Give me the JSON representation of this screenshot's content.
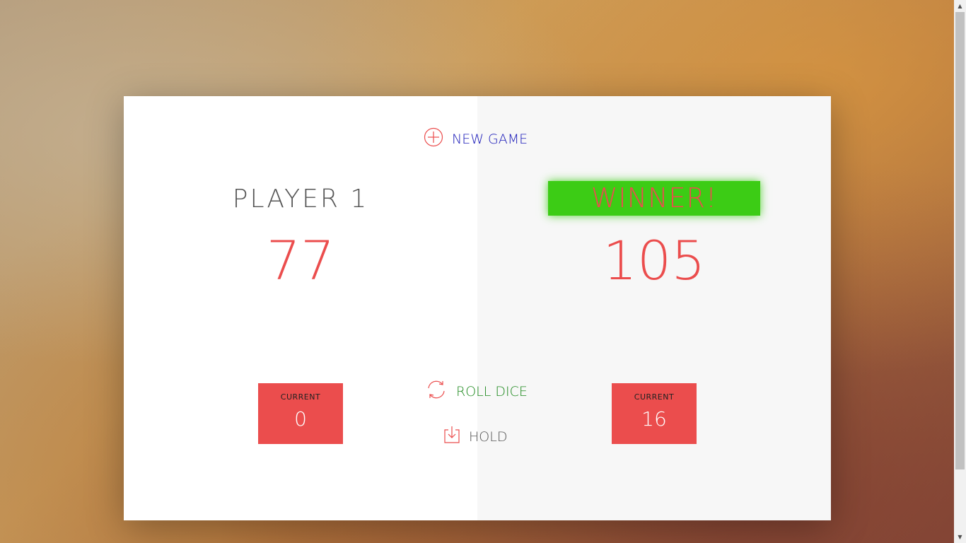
{
  "game": {
    "new_game_label": "NEW GAME",
    "roll_dice_label": "ROLL DICE",
    "hold_label": "HOLD"
  },
  "players": [
    {
      "name": "PLAYER 1",
      "score": "77",
      "current_label": "CURRENT",
      "current_score": "0"
    },
    {
      "name": "WINNER!",
      "score": "105",
      "current_label": "CURRENT",
      "current_score": "16"
    }
  ],
  "colors": {
    "accent_red": "#eb4d4d",
    "winner_green": "#3ccc15",
    "new_game_text": "#1a1ab8",
    "roll_dice_text": "#1f8a1f"
  },
  "icons": {
    "new_game": "plus-circle-icon",
    "roll_dice": "refresh-icon",
    "hold": "download-icon"
  }
}
